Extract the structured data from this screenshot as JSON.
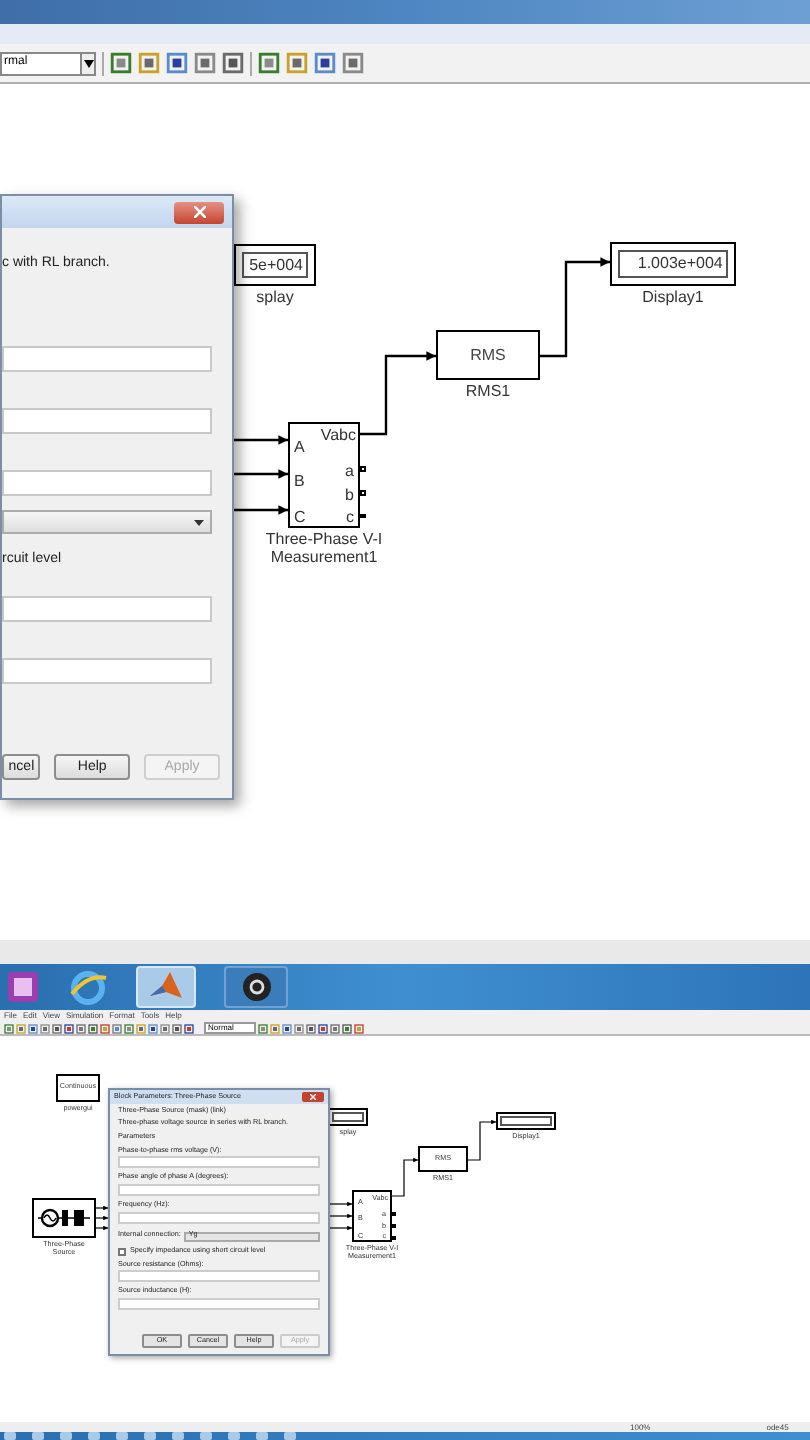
{
  "top_view": {
    "toolbar": {
      "dropdown_value": "rmal"
    },
    "dialog": {
      "description": "c with RL branch.",
      "rows": [
        {
          "kind": "field"
        },
        {
          "kind": "field"
        },
        {
          "kind": "field"
        },
        {
          "kind": "dropdown"
        },
        {
          "kind": "label",
          "text": "rcuit level"
        },
        {
          "kind": "field"
        },
        {
          "kind": "field"
        }
      ],
      "buttons": [
        {
          "label": "ncel",
          "disabled": false
        },
        {
          "label": "Help",
          "disabled": false
        },
        {
          "label": "Apply",
          "disabled": true
        }
      ]
    },
    "blocks": [
      {
        "kind": "display",
        "value": "5e+004",
        "label": "splay"
      },
      {
        "kind": "display",
        "value": "1.003e+004",
        "label": "Display1"
      },
      {
        "kind": "rms",
        "text": "RMS",
        "label": "RMS1"
      },
      {
        "kind": "measurement",
        "inputs": [
          "A",
          "B",
          "C"
        ],
        "output": "Vabc",
        "ports": [
          "a",
          "b",
          "c"
        ],
        "label": "Three-Phase V-I Measurement1"
      }
    ]
  },
  "bottom_view": {
    "menu": [
      "File",
      "Edit",
      "View",
      "Simulation",
      "Format",
      "Tools",
      "Help"
    ],
    "toolbar": {
      "dropdown_value": "Normal"
    },
    "blocks": [
      {
        "kind": "powergui",
        "text": "Continuous",
        "label": "powergui"
      },
      {
        "kind": "source",
        "label": "Three-Phase Source"
      },
      {
        "kind": "display",
        "label": "splay"
      },
      {
        "kind": "display",
        "label": "Display1"
      },
      {
        "kind": "rms",
        "text": "RMS",
        "label": "RMS1"
      },
      {
        "kind": "measurement",
        "inputs": [
          "A",
          "B",
          "C"
        ],
        "output": "Vabc",
        "ports": [
          "a",
          "b",
          "c"
        ],
        "label": "Three-Phase V-I Measurement1"
      }
    ],
    "dialog": {
      "title": "Block Parameters: Three-Phase Source",
      "header": "Three-Phase Source (mask) (link)",
      "description": "Three-phase voltage source in series with RL branch.",
      "section": "Parameters",
      "rows": [
        {
          "kind": "field",
          "label": "Phase-to-phase rms voltage (V):"
        },
        {
          "kind": "field",
          "label": "Phase angle of phase A (degrees):"
        },
        {
          "kind": "field",
          "label": "Frequency (Hz):"
        },
        {
          "kind": "dropdown",
          "label": "Internal connection:",
          "value": "Yg"
        },
        {
          "kind": "checkbox",
          "label": "Specify impedance using short circuit level",
          "checked": false
        },
        {
          "kind": "field",
          "label": "Source resistance (Ohms):"
        },
        {
          "kind": "field",
          "label": "Source inductance (H):"
        }
      ],
      "buttons": [
        {
          "label": "OK",
          "disabled": false
        },
        {
          "label": "Cancel",
          "disabled": false
        },
        {
          "label": "Help",
          "disabled": false
        },
        {
          "label": "Apply",
          "disabled": true
        }
      ]
    },
    "status_bar": [
      "100%",
      "ode45"
    ]
  }
}
